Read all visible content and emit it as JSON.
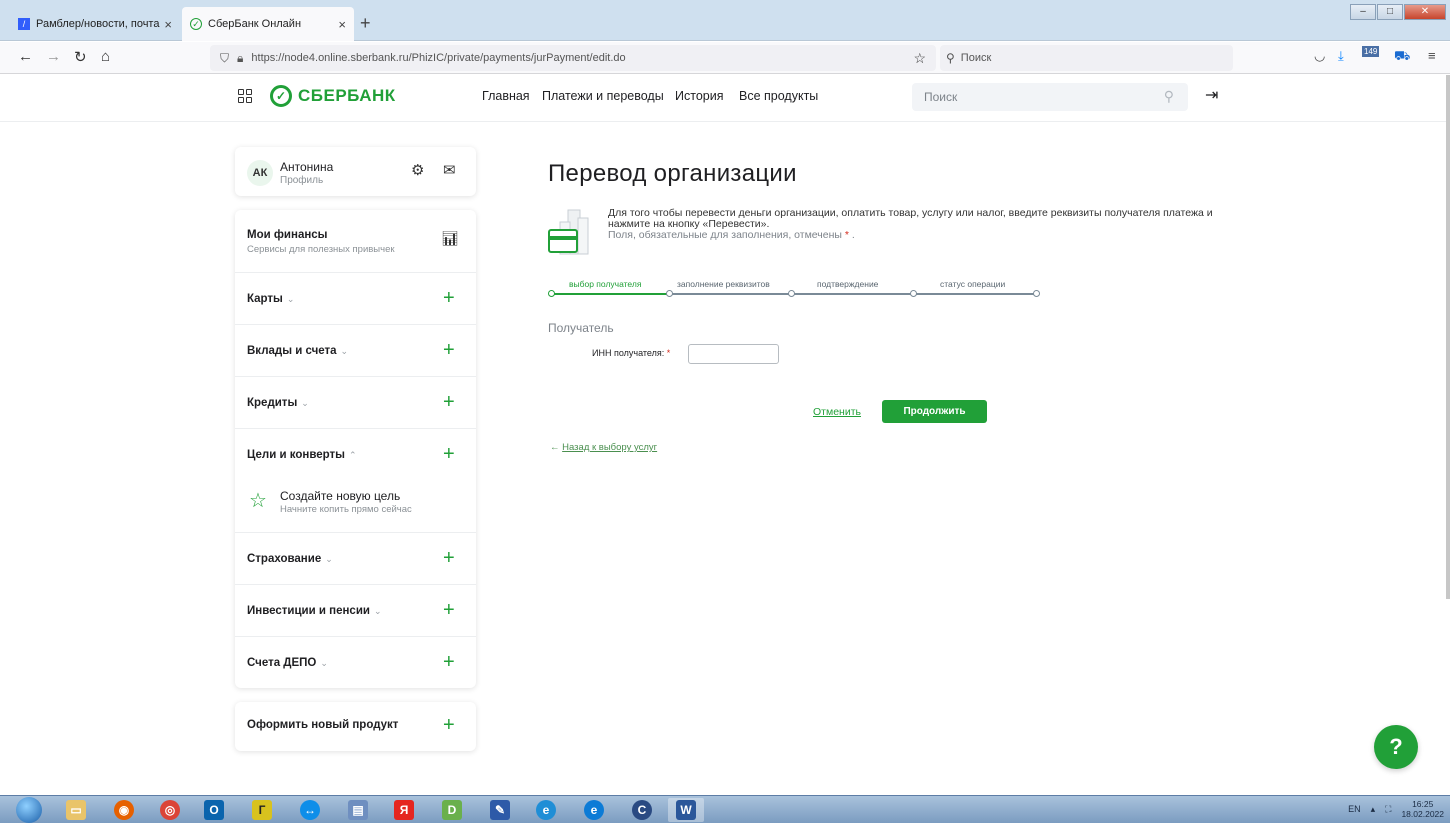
{
  "browser": {
    "tabs": [
      {
        "label": "Рамблер/новости, почта и по",
        "active": false
      },
      {
        "label": "СберБанк Онлайн",
        "active": true
      }
    ],
    "url": "https://node4.online.sberbank.ru/PhizIC/private/payments/jurPayment/edit.do",
    "search_placeholder": "Поиск",
    "badge_count": "149"
  },
  "header": {
    "brand": "СБЕРБАНК",
    "nav": [
      "Главная",
      "Платежи и переводы",
      "История",
      "Все продукты"
    ],
    "search_placeholder": "Поиск"
  },
  "profile": {
    "initials": "АК",
    "name": "Антонина",
    "subtitle": "Профиль"
  },
  "sidebar": {
    "finances": {
      "label": "Мои финансы",
      "subtitle": "Сервисы для полезных привычек"
    },
    "items": [
      {
        "label": "Карты",
        "chevron": "⌄"
      },
      {
        "label": "Вклады и счета",
        "chevron": "⌄"
      },
      {
        "label": "Кредиты",
        "chevron": "⌄"
      },
      {
        "label": "Цели и конверты",
        "chevron": "⌃"
      },
      {
        "label": "Страхование",
        "chevron": "⌄"
      },
      {
        "label": "Инвестиции и пенсии",
        "chevron": "⌄"
      },
      {
        "label": "Счета ДЕПО",
        "chevron": "⌄"
      }
    ],
    "goal": {
      "title": "Создайте новую цель",
      "subtitle": "Начните копить прямо сейчас"
    },
    "new_product": "Оформить новый продукт"
  },
  "main": {
    "title": "Перевод организации",
    "intro": "Для того чтобы перевести деньги организации, оплатить товар, услугу или налог, введите реквизиты получателя платежа и нажмите на кнопку «Перевести».",
    "required_note": "Поля, обязательные для заполнения, отмечены",
    "required_mark": "*",
    "steps": [
      "выбор получателя",
      "заполнение реквизитов",
      "подтверждение",
      "статус операции"
    ],
    "current_step": 0,
    "section_title": "Получатель",
    "inn_label": "ИНН получателя:",
    "inn_value": "",
    "cancel_label": "Отменить",
    "continue_label": "Продолжить",
    "back_label": "Назад к выбору услуг",
    "help_label": "?"
  },
  "taskbar": {
    "lang": "EN",
    "time": "16:25",
    "date": "18.02.2022"
  },
  "colors": {
    "accent": "#21a038",
    "required": "#d52b1e"
  }
}
